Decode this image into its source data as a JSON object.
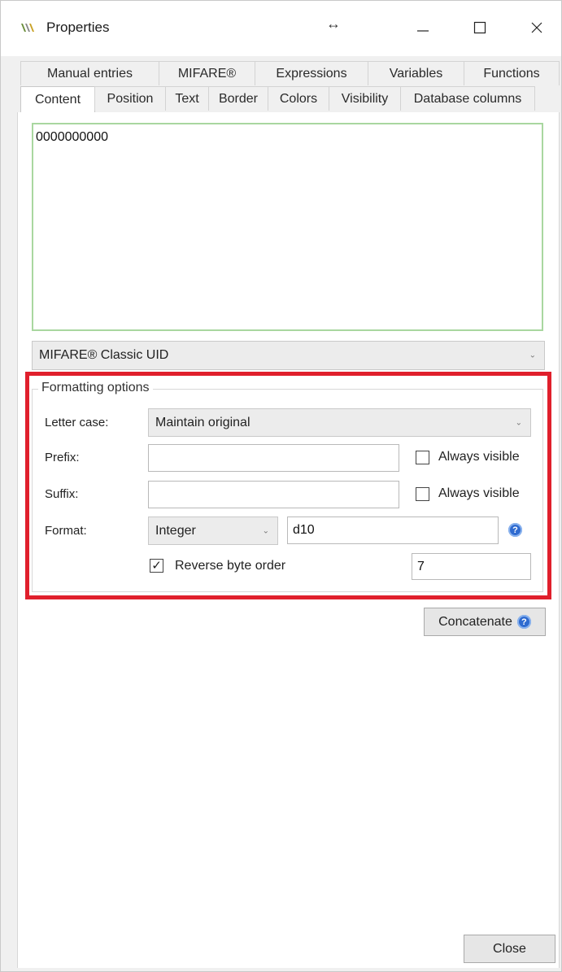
{
  "window": {
    "title": "Properties",
    "resize_glyph": "↔",
    "minimize_glyph": "—",
    "close_glyph": "✕"
  },
  "tabs": {
    "row_top": [
      "Manual entries",
      "MIFARE®",
      "Expressions",
      "Variables",
      "Functions"
    ],
    "row_bottom": [
      "Content",
      "Position",
      "Text",
      "Border",
      "Colors",
      "Visibility",
      "Database columns"
    ],
    "active": "Content"
  },
  "content": {
    "value": "0000000000",
    "source_select": "MIFARE® Classic UID"
  },
  "formatting": {
    "title": "Formatting options",
    "letter_case_label": "Letter case:",
    "letter_case_value": "Maintain original",
    "prefix_label": "Prefix:",
    "prefix_value": "",
    "prefix_always_visible_label": "Always visible",
    "prefix_always_visible": false,
    "suffix_label": "Suffix:",
    "suffix_value": "",
    "suffix_always_visible_label": "Always visible",
    "suffix_always_visible": false,
    "format_label": "Format:",
    "format_type": "Integer",
    "format_string": "d10",
    "reverse_byte_order_label": "Reverse byte order",
    "reverse_byte_order": true,
    "reverse_byte_count": "7"
  },
  "buttons": {
    "concatenate": "Concatenate",
    "close": "Close"
  },
  "colors": {
    "highlight": "#e01f2c",
    "help_icon": "#2f6bd0",
    "textarea_border": "#a9d7a0"
  }
}
